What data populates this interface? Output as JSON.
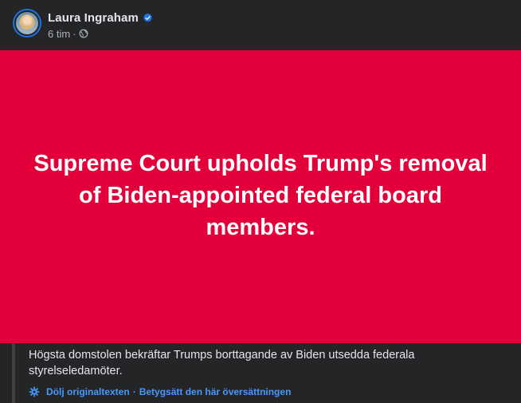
{
  "post": {
    "author": "Laura Ingraham",
    "verified": true,
    "time": "6 tim",
    "separator": "·",
    "privacy_icon": "globe-icon",
    "banner_color": "#e3003a",
    "headline": "Supreme Court upholds Trump's removal of Biden-appointed federal board members.",
    "translation": {
      "text": "Högsta domstolen bekräftar Trumps borttagande av Biden utsedda federala styrelseledamöter.",
      "hide_original_label": "Dölj originaltexten",
      "separator": "·",
      "rate_translation_label": "Betygsätt den här översättningen",
      "link_color": "#4599ff"
    }
  },
  "colors": {
    "background": "#242526",
    "primary_text": "#e4e6eb",
    "secondary_text": "#b0b3b8",
    "verified_badge": "#1b74e4"
  }
}
